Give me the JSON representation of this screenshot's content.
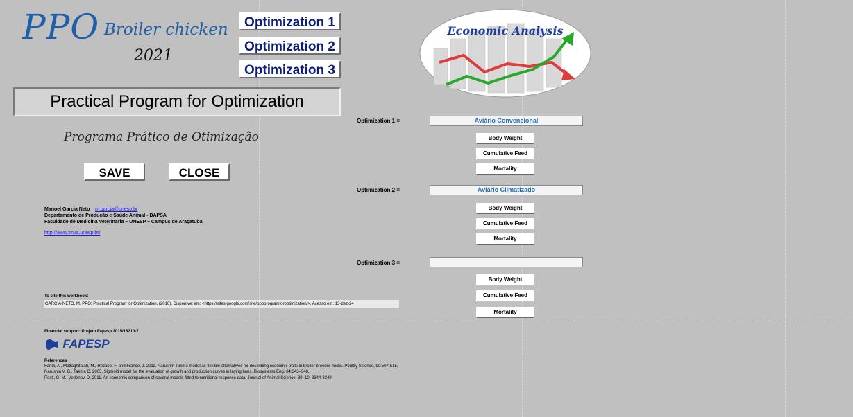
{
  "logo": {
    "ppo": "PPO",
    "subtitle": "Broiler chicken",
    "year": "2021"
  },
  "nav": {
    "opt1": "Optimization 1",
    "opt2": "Optimization 2",
    "opt3": "Optimization 3"
  },
  "program": {
    "title": "Practical Program for Optimization",
    "subtitle_pt": "Programa Prático de Otimização"
  },
  "actions": {
    "save": "SAVE",
    "close": "CLOSE"
  },
  "author": {
    "name": "Manoel Garcia Neto",
    "email": "m.garcia@unesp.br",
    "dept": "Departamento de Produção e Saúde Animal - DAPSA",
    "faculty": "Faculdade de Medicina Veterinária – UNESP – Campus de Araçatuba",
    "url": "http://www.fmva.unesp.br/"
  },
  "citation": {
    "label": "To cite this workbook:",
    "text": "GARCIA-NETO, M. PPO: Practical Program for Optimization. (2016). Disponível em: <https://sites.google.com/site/ppoprogramforoptimization/>. Acesso em: 13-dez-24"
  },
  "economic": {
    "title": "Economic Analysis"
  },
  "optimizations": [
    {
      "label": "Optimization 1 =",
      "value": "Aviário Convencional",
      "buttons": [
        "Body Weight",
        "Cumulative Feed",
        "Mortality"
      ]
    },
    {
      "label": "Optimization 2 =",
      "value": "Aviário Climatizado",
      "buttons": [
        "Body Weight",
        "Cumulative Feed",
        "Mortality"
      ]
    },
    {
      "label": "Optimization 3 =",
      "value": "",
      "buttons": [
        "Body Weight",
        "Cumulative Feed",
        "Mortality"
      ]
    }
  ],
  "funding": {
    "text": "Financial support: Projeto Fapesp 2015/18210-7",
    "logo": "FAPESP"
  },
  "references": {
    "heading": "References",
    "items": [
      "Faridi, A., Mottaghitalab, M., Rezaee, F. and France, J. 2011. Narushin-Takma model as flexible alternatives for describing economic traits in broiler breeder flocks. Poultry Science, 90:507-515.",
      "Narushin V. G., Takma C. 2003. Sigmoid model for the evaluation of growth and production curves in laying hens. Biosystems Eng. 84:343–348.",
      "Pesti, G. M., Vedenov, D. 2011. An economic comparison of several models fitted to nutritional response data. Journal of Animal Science, 89: 10: 3344-3349"
    ]
  }
}
